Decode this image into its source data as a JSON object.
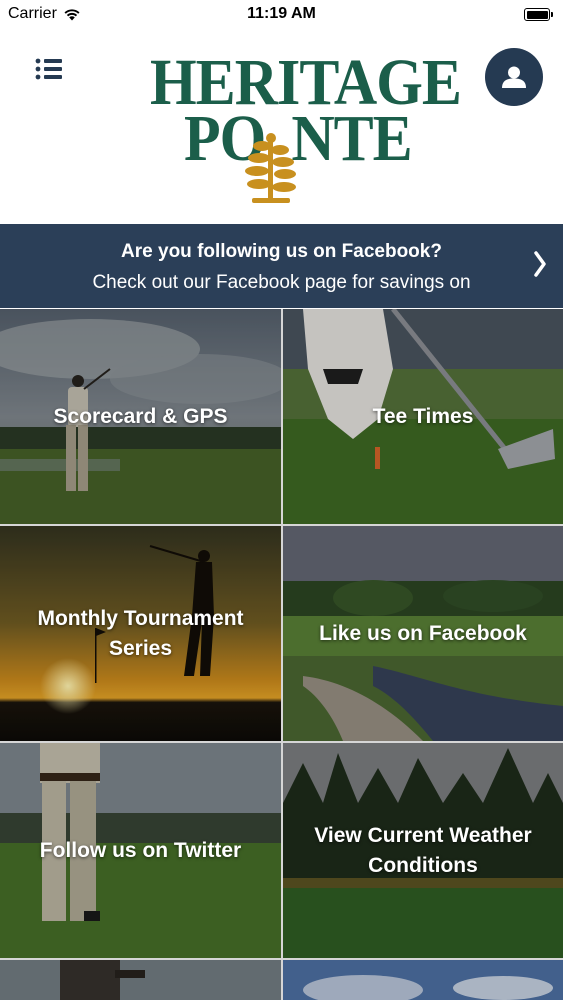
{
  "status_bar": {
    "carrier": "Carrier",
    "time": "11:19 AM",
    "battery_level": 1.0
  },
  "header": {
    "menu_icon": "list-menu-icon",
    "profile_icon": "user-profile-icon",
    "logo_line1": "HERITAGE",
    "logo_line2": "POINTE",
    "logo_line2_prefix": "PO",
    "logo_line2_suffix": "NTE"
  },
  "banner": {
    "title": "Are you following us on Facebook?",
    "subtitle": "Check out our Facebook page for savings on",
    "chevron_icon": "chevron-right-icon"
  },
  "tiles": [
    {
      "label": "Scorecard & GPS"
    },
    {
      "label": "Tee Times"
    },
    {
      "label": "Monthly Tournament\nSeries"
    },
    {
      "label": "Like us on Facebook"
    },
    {
      "label": "Follow us on Twitter"
    },
    {
      "label": "View Current Weather\nConditions"
    }
  ],
  "colors": {
    "brand_green": "#1b5e4a",
    "brand_gold": "#c8901f",
    "banner_navy": "#2b3f58",
    "profile_navy": "#253a52"
  }
}
